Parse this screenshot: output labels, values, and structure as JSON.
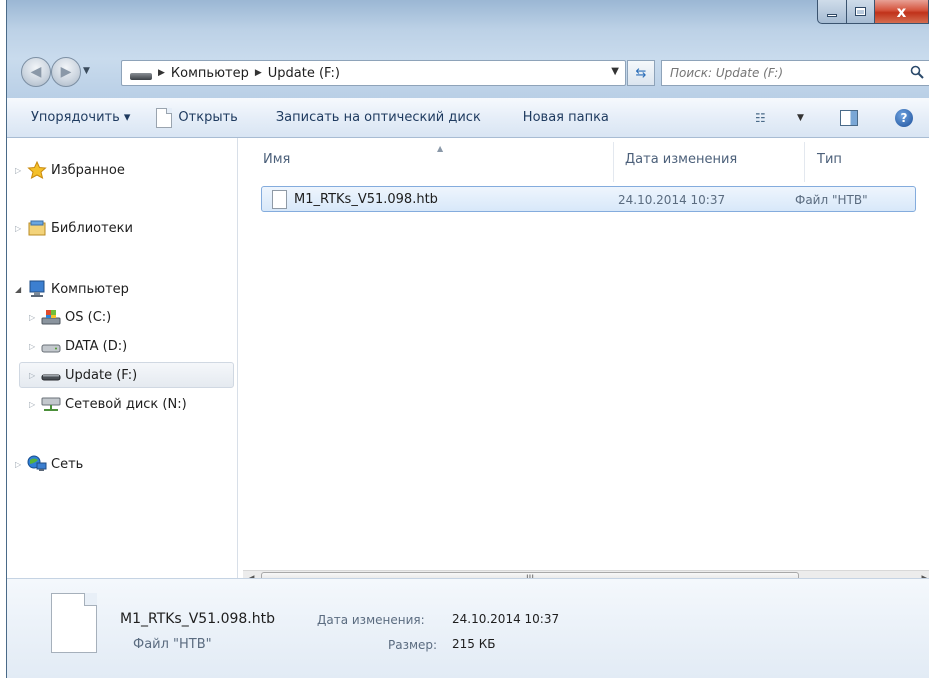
{
  "window": {
    "caption_close": "x"
  },
  "address": {
    "crumbs": [
      "Компьютер",
      "Update (F:)"
    ]
  },
  "search": {
    "placeholder": "Поиск: Update (F:)"
  },
  "toolbar": {
    "organize": "Упорядочить ▾",
    "open": "Открыть",
    "burn": "Записать на оптический диск",
    "new_folder": "Новая папка"
  },
  "nav": {
    "favorites": "Избранное",
    "libraries": "Библиотеки",
    "computer": "Компьютер",
    "drives": [
      {
        "label": "OS (C:)",
        "icon": "os-drive-icon"
      },
      {
        "label": "DATA (D:)",
        "icon": "hard-drive-icon"
      },
      {
        "label": "Update (F:)",
        "icon": "removable-drive-icon",
        "selected": true
      },
      {
        "label": "Сетевой диск (N:)",
        "icon": "network-drive-icon"
      }
    ],
    "network": "Сеть"
  },
  "columns": {
    "name": "Имя",
    "date": "Дата изменения",
    "type": "Тип"
  },
  "files": [
    {
      "name": "M1_RTKs_V51.098.htb",
      "date": "24.10.2014 10:37",
      "type": "Файл \"HTB\""
    }
  ],
  "details": {
    "name": "M1_RTKs_V51.098.htb",
    "type": "Файл \"HTB\"",
    "date_label": "Дата изменения:",
    "date_value": "24.10.2014 10:37",
    "size_label": "Размер:",
    "size_value": "215 КБ"
  },
  "scrollbar": {
    "thumb_grip": "III"
  },
  "colors": {
    "selection_border": "#84acdd",
    "selection_fill": "#d8e8f9",
    "toolbar_text": "#1e3a5f",
    "close_button": "#c0321a"
  }
}
